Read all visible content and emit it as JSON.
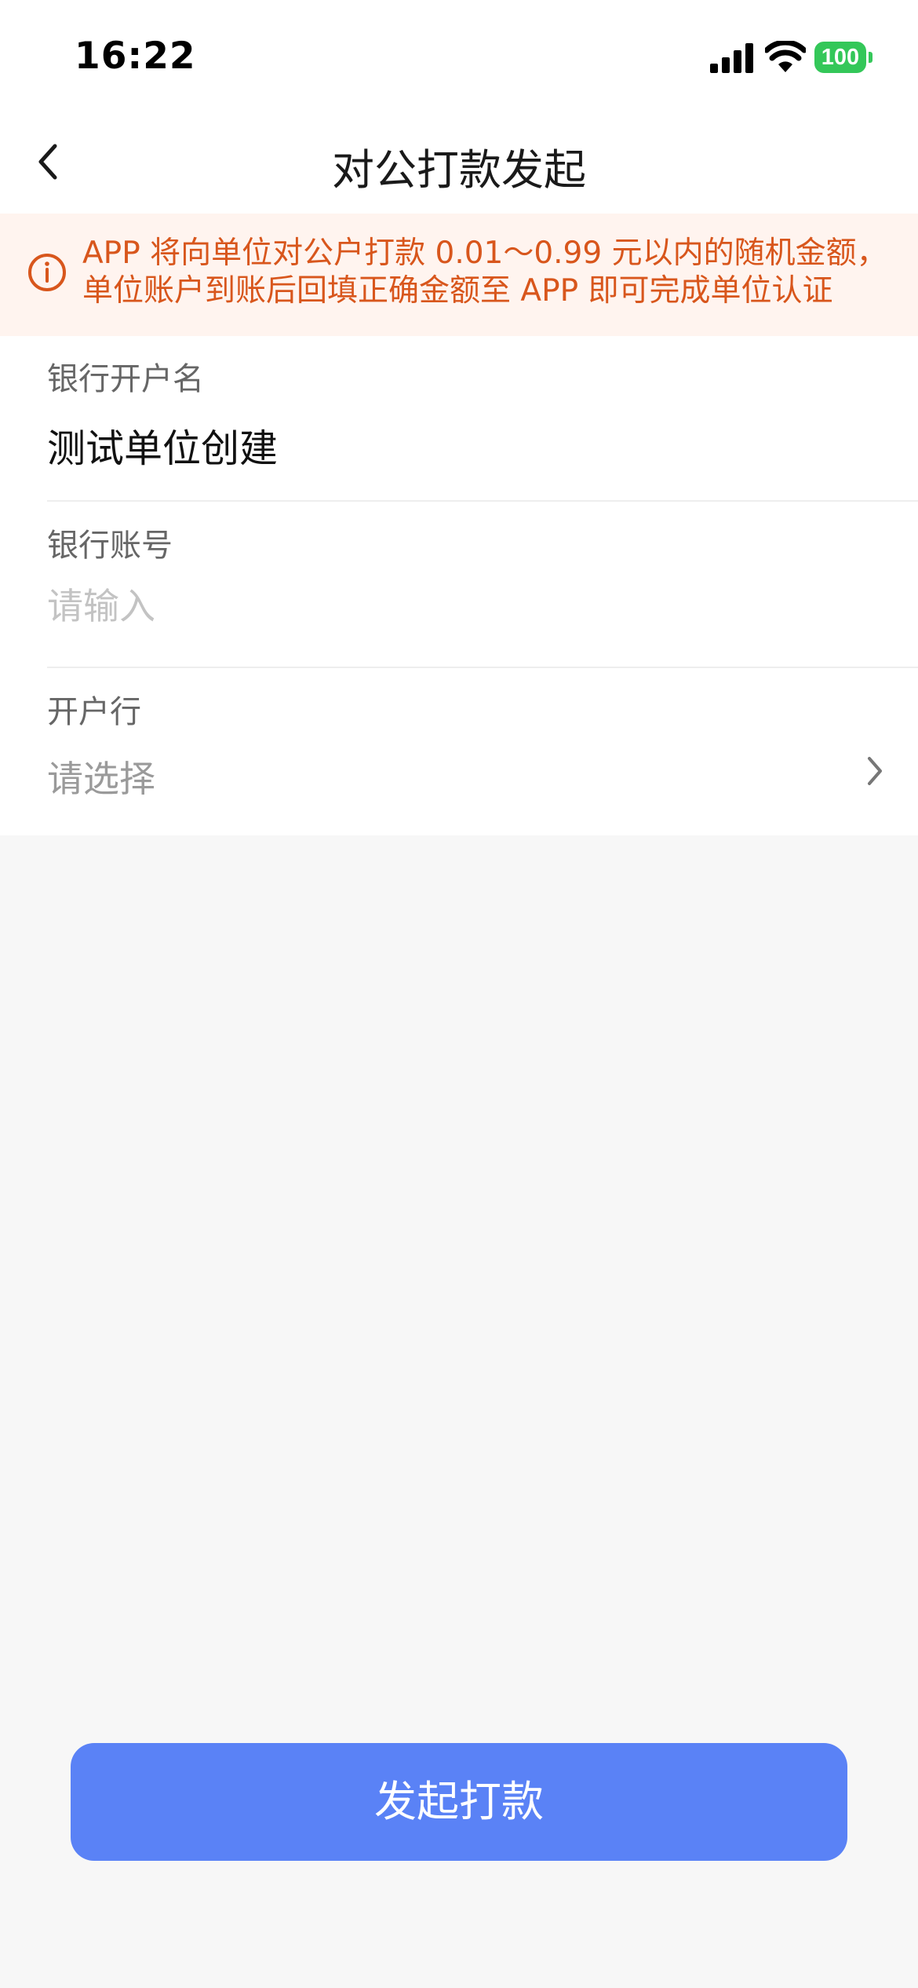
{
  "status_bar": {
    "time": "16:22",
    "battery": "100",
    "icons": [
      "signal-icon",
      "wifi-icon",
      "battery-icon"
    ]
  },
  "nav": {
    "title": "对公打款发起",
    "back_icon": "chevron-left-icon"
  },
  "notice": {
    "icon": "info-circle-icon",
    "text": "APP 将向单位对公户打款 0.01～0.99 元以内的随机金额，单位账户到账后回填正确金额至 APP 即可完成单位认证",
    "color": "#d8561c",
    "background": "#fff4ef"
  },
  "form": {
    "account_name": {
      "label": "银行开户名",
      "value": "测试单位创建"
    },
    "account_number": {
      "label": "银行账号",
      "placeholder": "请输入"
    },
    "bank": {
      "label": "开户行",
      "placeholder": "请选择",
      "icon": "chevron-right-icon"
    }
  },
  "submit": {
    "label": "发起打款",
    "color": "#5a82f6"
  }
}
